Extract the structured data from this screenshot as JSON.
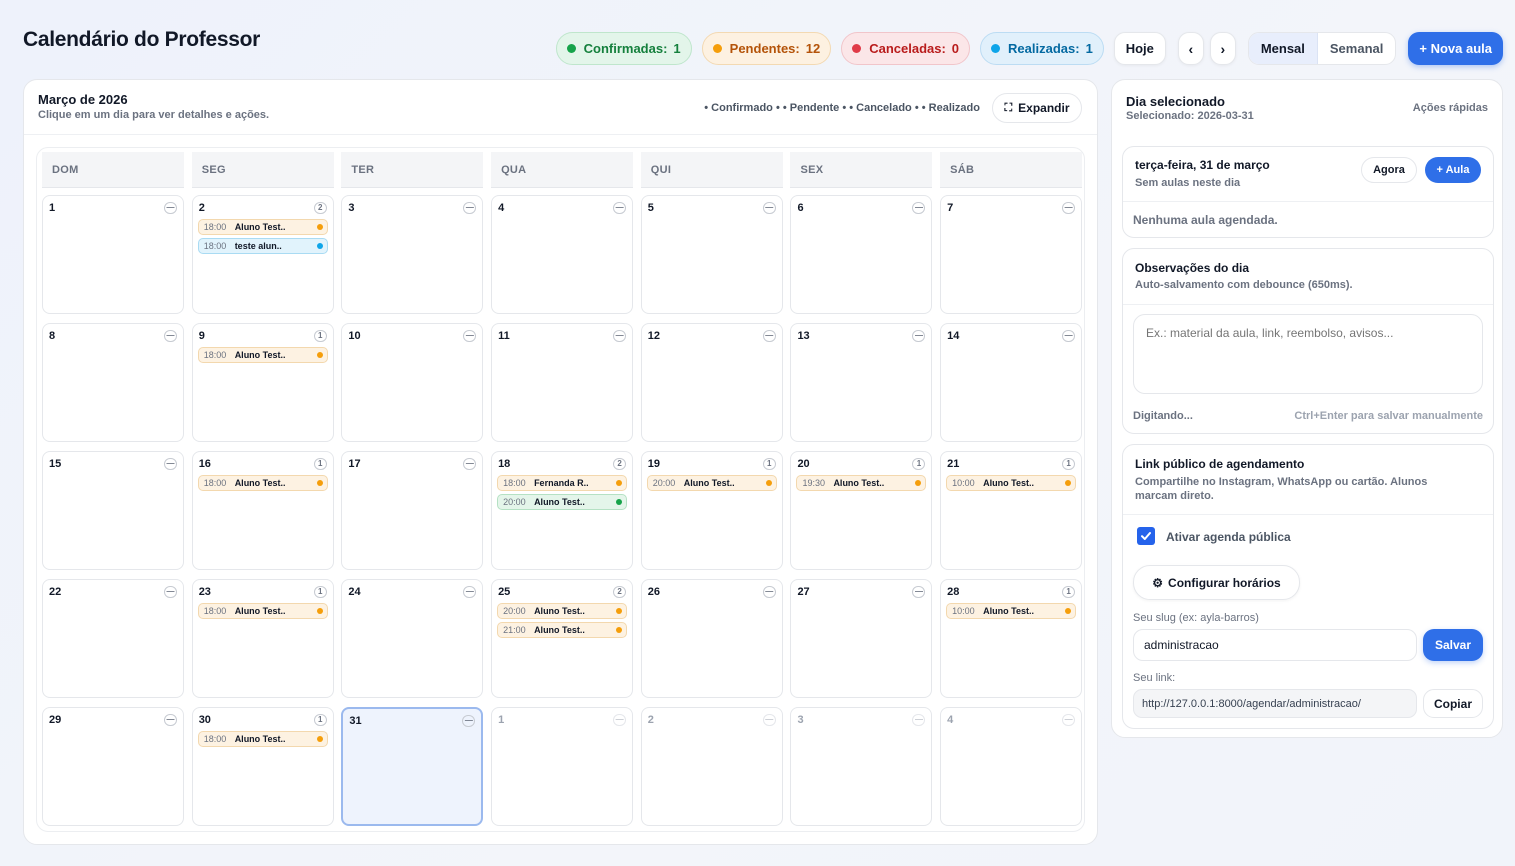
{
  "header": {
    "title": "Calendário do Professor",
    "stats": [
      {
        "label": "Confirmadas:",
        "count": "1",
        "color": "#16a34a"
      },
      {
        "label": "Pendentes:",
        "count": "12",
        "color": "#f59e0b"
      },
      {
        "label": "Canceladas:",
        "count": "0",
        "color": "#e03b48"
      },
      {
        "label": "Realizadas:",
        "count": "1",
        "color": "#0ea5e9"
      }
    ],
    "today_label": "Hoje",
    "prev_label": "‹",
    "next_label": "›",
    "view_monthly": "Mensal",
    "view_weekly": "Semanal",
    "new_class_label": "+ Nova aula"
  },
  "calendar": {
    "month_title": "Março de 2026",
    "subtitle": "Clique em um dia para ver detalhes e ações.",
    "legend": "• Confirmado • • Pendente • • Cancelado • • Realizado",
    "expand_label": "Expandir",
    "weekdays": [
      "DOM",
      "SEG",
      "TER",
      "QUA",
      "QUI",
      "SEX",
      "SÁB"
    ],
    "selected_day": "31",
    "days": [
      {
        "num": "1",
        "badge": "—",
        "events": []
      },
      {
        "num": "2",
        "badge": "2",
        "events": [
          {
            "time": "18:00",
            "name": "Aluno Test..",
            "status": "pend"
          },
          {
            "time": "18:00",
            "name": "teste alun..",
            "status": "real"
          }
        ]
      },
      {
        "num": "3",
        "badge": "—",
        "events": []
      },
      {
        "num": "4",
        "badge": "—",
        "events": []
      },
      {
        "num": "5",
        "badge": "—",
        "events": []
      },
      {
        "num": "6",
        "badge": "—",
        "events": []
      },
      {
        "num": "7",
        "badge": "—",
        "events": []
      },
      {
        "num": "8",
        "badge": "—",
        "events": []
      },
      {
        "num": "9",
        "badge": "1",
        "events": [
          {
            "time": "18:00",
            "name": "Aluno Test..",
            "status": "pend"
          }
        ]
      },
      {
        "num": "10",
        "badge": "—",
        "events": []
      },
      {
        "num": "11",
        "badge": "—",
        "events": []
      },
      {
        "num": "12",
        "badge": "—",
        "events": []
      },
      {
        "num": "13",
        "badge": "—",
        "events": []
      },
      {
        "num": "14",
        "badge": "—",
        "events": []
      },
      {
        "num": "15",
        "badge": "—",
        "events": []
      },
      {
        "num": "16",
        "badge": "1",
        "events": [
          {
            "time": "18:00",
            "name": "Aluno Test..",
            "status": "pend"
          }
        ]
      },
      {
        "num": "17",
        "badge": "—",
        "events": []
      },
      {
        "num": "18",
        "badge": "2",
        "events": [
          {
            "time": "18:00",
            "name": "Fernanda R..",
            "status": "pend"
          },
          {
            "time": "20:00",
            "name": "Aluno Test..",
            "status": "conf"
          }
        ]
      },
      {
        "num": "19",
        "badge": "1",
        "events": [
          {
            "time": "20:00",
            "name": "Aluno Test..",
            "status": "pend"
          }
        ]
      },
      {
        "num": "20",
        "badge": "1",
        "events": [
          {
            "time": "19:30",
            "name": "Aluno Test..",
            "status": "pend"
          }
        ]
      },
      {
        "num": "21",
        "badge": "1",
        "events": [
          {
            "time": "10:00",
            "name": "Aluno Test..",
            "status": "pend"
          }
        ]
      },
      {
        "num": "22",
        "badge": "—",
        "events": []
      },
      {
        "num": "23",
        "badge": "1",
        "events": [
          {
            "time": "18:00",
            "name": "Aluno Test..",
            "status": "pend"
          }
        ]
      },
      {
        "num": "24",
        "badge": "—",
        "events": []
      },
      {
        "num": "25",
        "badge": "2",
        "events": [
          {
            "time": "20:00",
            "name": "Aluno Test..",
            "status": "pend"
          },
          {
            "time": "21:00",
            "name": "Aluno Test..",
            "status": "pend"
          }
        ]
      },
      {
        "num": "26",
        "badge": "—",
        "events": []
      },
      {
        "num": "27",
        "badge": "—",
        "events": []
      },
      {
        "num": "28",
        "badge": "1",
        "events": [
          {
            "time": "10:00",
            "name": "Aluno Test..",
            "status": "pend"
          }
        ]
      },
      {
        "num": "29",
        "badge": "—",
        "events": []
      },
      {
        "num": "30",
        "badge": "1",
        "events": [
          {
            "time": "18:00",
            "name": "Aluno Test..",
            "status": "pend"
          }
        ]
      },
      {
        "num": "31",
        "badge": "—",
        "events": [],
        "selected": true
      },
      {
        "num": "1",
        "badge": "—",
        "events": [],
        "outside": true
      },
      {
        "num": "2",
        "badge": "—",
        "events": [],
        "outside": true
      },
      {
        "num": "3",
        "badge": "—",
        "events": [],
        "outside": true
      },
      {
        "num": "4",
        "badge": "—",
        "events": [],
        "outside": true
      }
    ]
  },
  "sidebar": {
    "title": "Dia selecionado",
    "selected_text": "Selecionado: 2026-03-31",
    "quick_actions": "Ações rápidas",
    "day_card": {
      "date": "terça-feira, 31 de março",
      "no_classes": "Sem aulas neste dia",
      "now_label": "Agora",
      "add_class_label": "+ Aula",
      "empty": "Nenhuma aula agendada."
    },
    "notes_card": {
      "title": "Observações do dia",
      "subtitle": "Auto-salvamento com debounce (650ms).",
      "placeholder": "Ex.: material da aula, link, reembolso, avisos...",
      "status": "Digitando...",
      "hint": "Ctrl+Enter para salvar manualmente"
    },
    "public_card": {
      "title": "Link público de agendamento",
      "subtitle": "Compartilhe no Instagram, WhatsApp ou cartão. Alunos marcam direto.",
      "enable_label": "Ativar agenda pública",
      "enabled": true,
      "configure_label": "Configurar horários",
      "slug_label": "Seu slug (ex: ayla-barros)",
      "slug_value": "administracao",
      "save_label": "Salvar",
      "link_label": "Seu link:",
      "link_value": "http://127.0.0.1:8000/agendar/administracao/",
      "copy_label": "Copiar"
    }
  }
}
